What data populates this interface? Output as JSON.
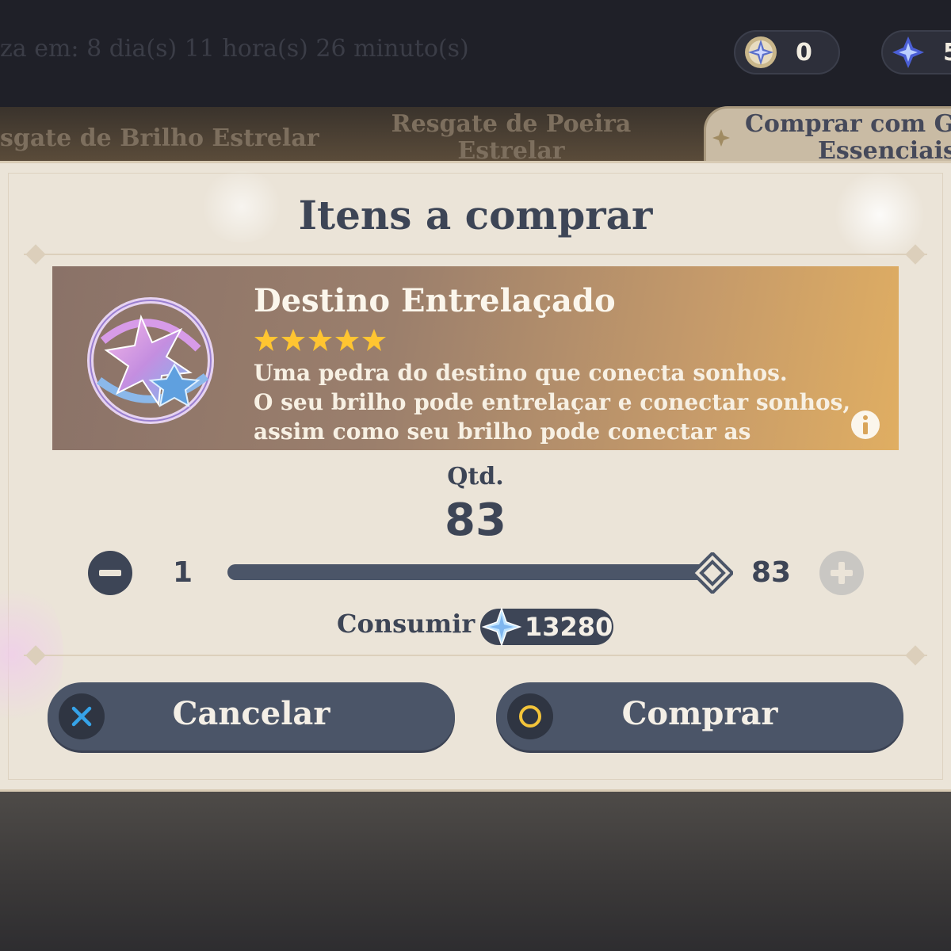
{
  "header": {
    "refresh_text": "za em: 8 dia(s) 11 hora(s) 26 minuto(s)",
    "currencies": [
      {
        "icon": "masterless-starglitter-icon",
        "value": "0"
      },
      {
        "icon": "masterless-stardust-icon",
        "value": "5"
      }
    ]
  },
  "tabs": [
    {
      "label": "sgate de Brilho Estrelar",
      "active": false
    },
    {
      "label_line1": "Resgate de Poeira",
      "label_line2": "Estrelar",
      "active": false
    },
    {
      "label_line1": "Comprar com G",
      "label_line2": "Essenciais",
      "active": true
    }
  ],
  "dialog": {
    "title": "Itens a comprar",
    "item": {
      "name": "Destino Entrelaçado",
      "rarity_stars": 5,
      "description_lines": [
        "Uma pedra do destino que conecta sonhos.",
        "O seu brilho pode entrelaçar e conectar sonhos,",
        "assim como seu brilho pode conectar as"
      ],
      "icon": "intertwined-fate-icon"
    },
    "quantity": {
      "label": "Qtd.",
      "value": "83",
      "min": "1",
      "max": "83",
      "slider_fraction": 1.0
    },
    "consume": {
      "label": "Consumir",
      "amount": "13280",
      "icon": "primogem-icon"
    },
    "buttons": {
      "cancel": "Cancelar",
      "buy": "Comprar"
    }
  },
  "colors": {
    "dialog_bg": "#ebe4d8",
    "text_dark": "#3d4556",
    "button_bg": "#4b5568",
    "star_gold": "#ffc531",
    "cancel_x": "#36a3e8",
    "buy_circle": "#f3c43a"
  }
}
